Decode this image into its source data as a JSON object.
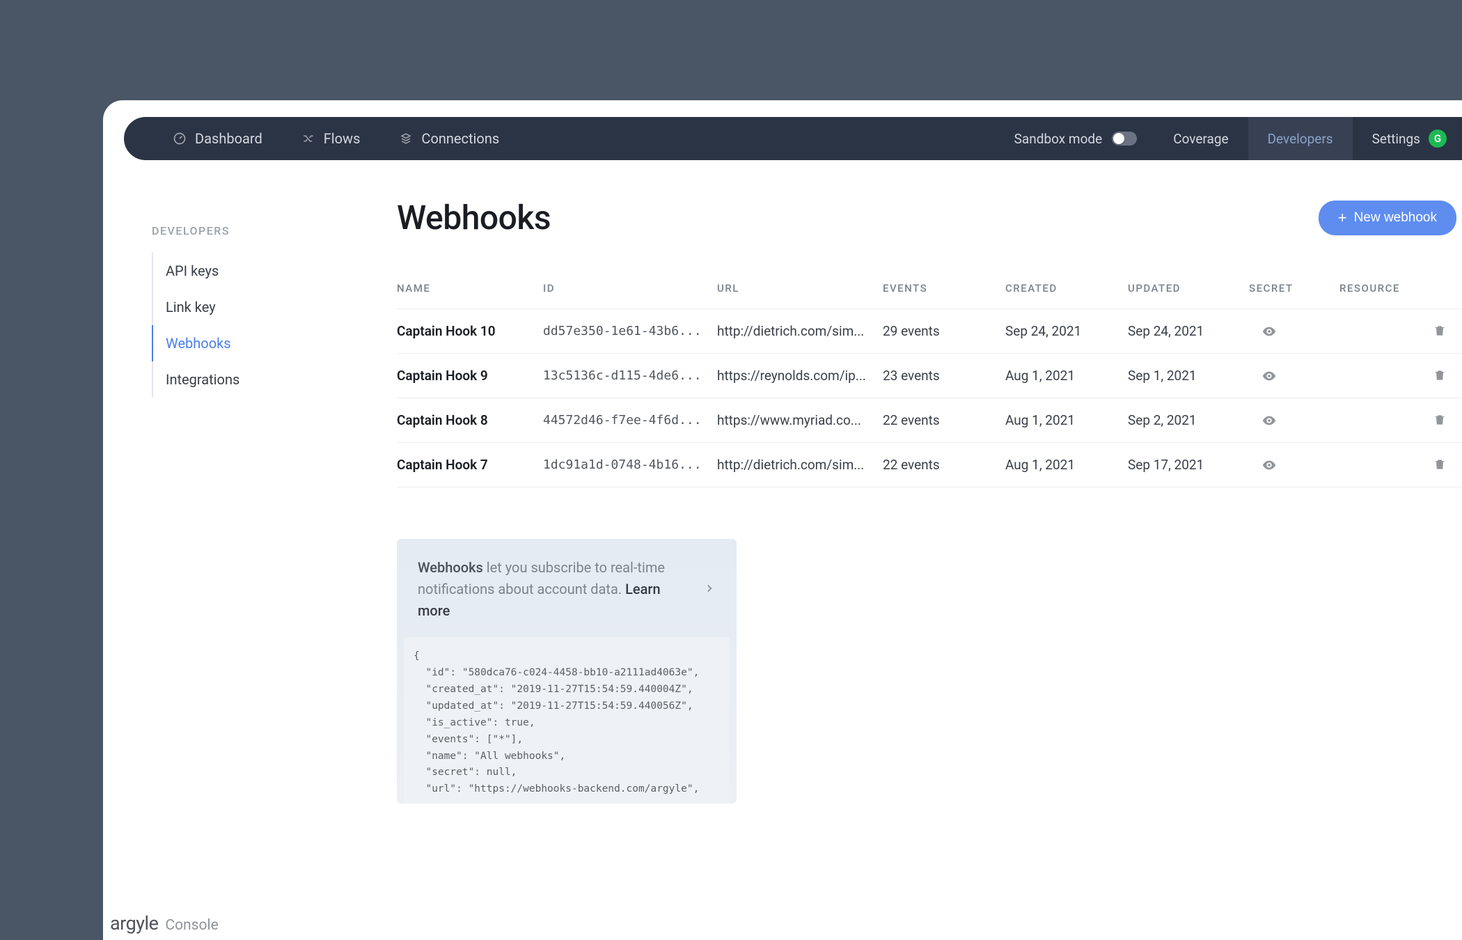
{
  "nav": {
    "dashboard": "Dashboard",
    "flows": "Flows",
    "connections": "Connections",
    "sandbox": "Sandbox mode",
    "coverage": "Coverage",
    "developers": "Developers",
    "settings": "Settings",
    "avatar_initial": "G"
  },
  "sidebar": {
    "title": "DEVELOPERS",
    "items": [
      "API keys",
      "Link key",
      "Webhooks",
      "Integrations"
    ],
    "active_index": 2
  },
  "page": {
    "title": "Webhooks",
    "new_button": "New webhook"
  },
  "table": {
    "headers": [
      "NAME",
      "ID",
      "URL",
      "EVENTS",
      "CREATED",
      "UPDATED",
      "SECRET",
      "RESOURCE"
    ],
    "rows": [
      {
        "name": "Captain Hook 10",
        "id": "dd57e350-1e61-43b6...",
        "url": "http://dietrich.com/sim...",
        "events": "29 events",
        "created": "Sep 24, 2021",
        "updated": "Sep 24, 2021"
      },
      {
        "name": "Captain Hook 9",
        "id": "13c5136c-d115-4de6...",
        "url": "https://reynolds.com/ip...",
        "events": "23 events",
        "created": "Aug 1, 2021",
        "updated": "Sep 1, 2021"
      },
      {
        "name": "Captain Hook 8",
        "id": "44572d46-f7ee-4f6d...",
        "url": "https://www.myriad.co...",
        "events": "22 events",
        "created": "Aug 1, 2021",
        "updated": "Sep 2, 2021"
      },
      {
        "name": "Captain Hook 7",
        "id": "1dc91a1d-0748-4b16...",
        "url": "http://dietrich.com/sim...",
        "events": "22 events",
        "created": "Aug 1, 2021",
        "updated": "Sep 17, 2021"
      }
    ]
  },
  "info_card": {
    "lead": "Webhooks",
    "body": " let you subscribe to real-time notifications about account data. ",
    "learn": "Learn more",
    "code": "{\n  \"id\": \"580dca76-c024-4458-bb10-a2111ad4063e\",\n  \"created_at\": \"2019-11-27T15:54:59.440004Z\",\n  \"updated_at\": \"2019-11-27T15:54:59.440056Z\",\n  \"is_active\": true,\n  \"events\": [\"*\"],\n  \"name\": \"All webhooks\",\n  \"secret\": null,\n  \"url\": \"https://webhooks-backend.com/argyle\","
  },
  "footer": {
    "brand": "argyle",
    "sub": "Console"
  }
}
